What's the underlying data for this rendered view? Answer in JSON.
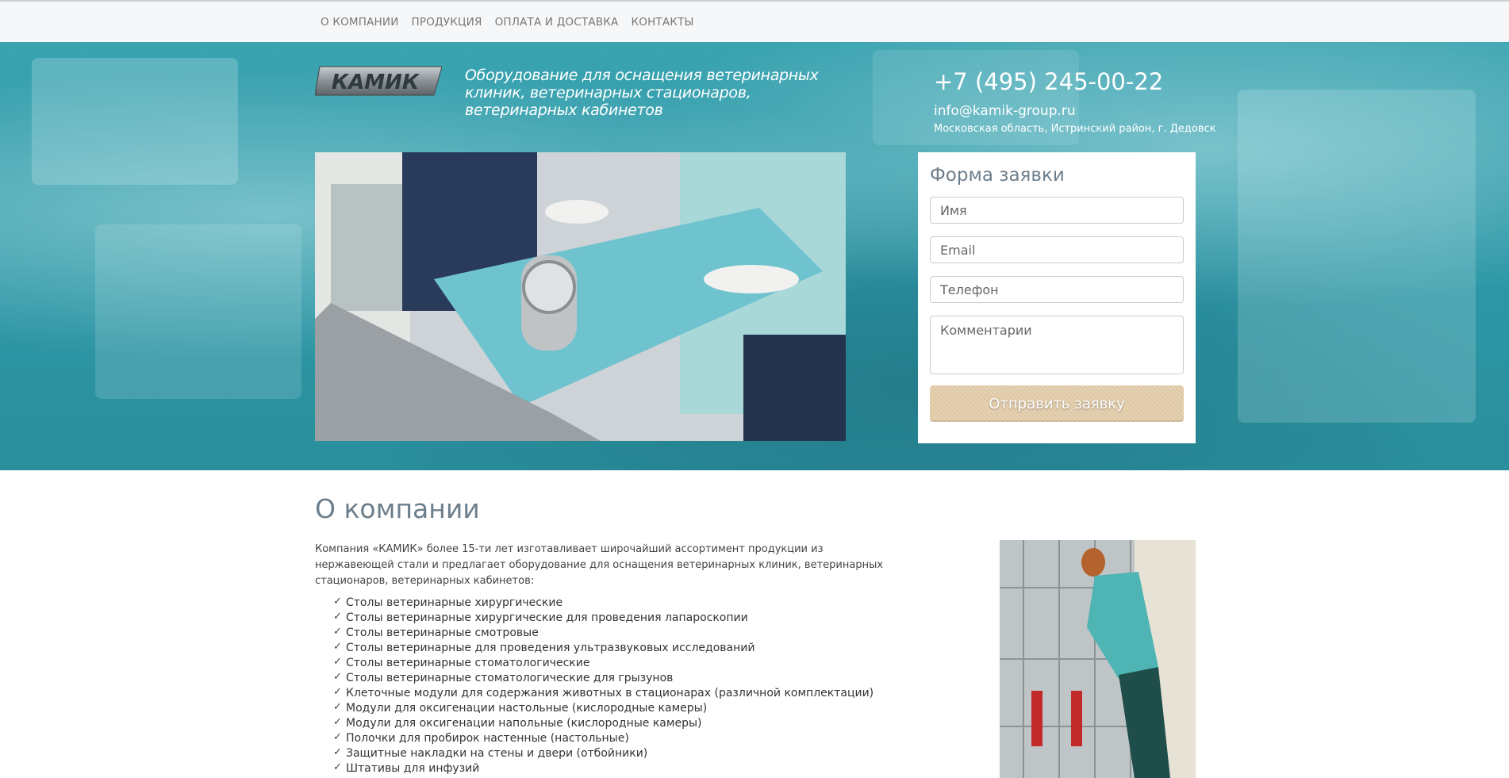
{
  "nav": {
    "items": [
      {
        "label": "О КОМПАНИИ"
      },
      {
        "label": "ПРОДУКЦИЯ"
      },
      {
        "label": "ОПЛАТА И ДОСТАВКА"
      },
      {
        "label": "КОНТАКТЫ"
      }
    ]
  },
  "header": {
    "logo_text": "КАМИК",
    "tagline": "Оборудование для оснащения ветеринарных клиник, ветеринарных стационаров, ветеринарных кабинетов",
    "phone": "+7 (495) 245-00-22",
    "email": "info@kamik-group.ru",
    "address": "Московская область, Истринский район, г. Дедовск"
  },
  "form": {
    "title": "Форма заявки",
    "name_placeholder": "Имя",
    "email_placeholder": "Email",
    "phone_placeholder": "Телефон",
    "comment_placeholder": "Комментарии",
    "submit_label": "Отправить заявку"
  },
  "about": {
    "title": "О компании",
    "intro": "Компания «КАМИК» более 15-ти лет изготавливает широчайший ассортимент продукции из нержавеющей стали и предлагает оборудование для оснащения ветеринарных клиник, ветеринарных стационаров, ветеринарных кабинетов:",
    "items": [
      "Столы ветеринарные хирургические",
      "Столы ветеринарные хирургические для проведения лапароскопии",
      "Столы ветеринарные смотровые",
      "Столы ветеринарные для проведения ультразвуковых исследований",
      "Столы ветеринарные стоматологические",
      "Столы ветеринарные стоматологические для грызунов",
      "Клеточные модули для содержания животных в стационарах (различной комплектации)",
      "Модули для оксигенации настольные (кислородные камеры)",
      "Модули для оксигенации напольные (кислородные камеры)",
      "Полочки для пробирок настенные (настольные)",
      "Защитные накладки на стены и двери (отбойники)",
      "Штативы для инфузий"
    ]
  },
  "colors": {
    "hero": "#2f9aa8",
    "heading": "#6d7f8c",
    "button": "#dcc4a0"
  }
}
